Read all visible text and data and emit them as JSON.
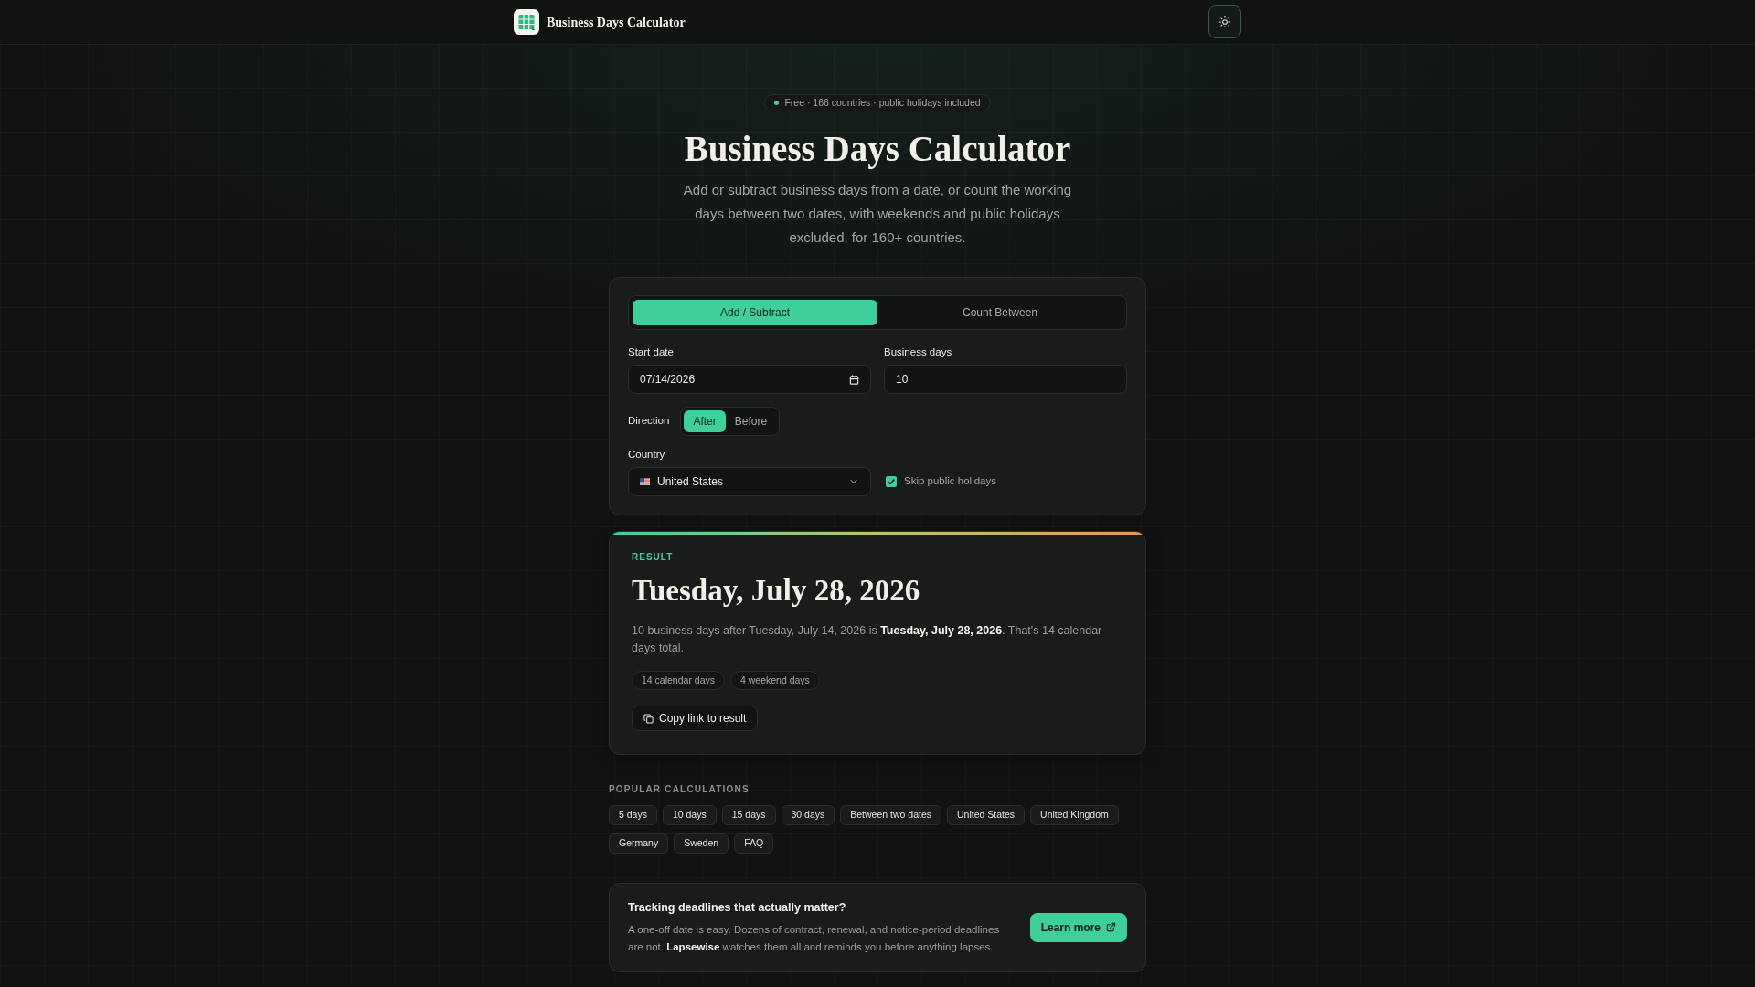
{
  "header": {
    "title": "Business Days Calculator"
  },
  "hero": {
    "badge": "Free · 166 countries · public holidays included",
    "title": "Business Days Calculator",
    "subtitle": "Add or subtract business days from a date, or count the working days between two dates, with weekends and public holidays excluded, for 160+ countries."
  },
  "calculator": {
    "tabs": [
      {
        "label": "Add / Subtract",
        "selected": true
      },
      {
        "label": "Count Between",
        "selected": false
      }
    ],
    "fields": [
      {
        "kind": "date",
        "label": "Start date",
        "value": "07/14/2026"
      },
      {
        "kind": "number",
        "label": "Business days",
        "value": "10"
      }
    ],
    "direction": {
      "label": "Direction",
      "options": [
        {
          "label": "After",
          "selected": true
        },
        {
          "label": "Before",
          "selected": false
        }
      ]
    },
    "country": {
      "label": "Country",
      "value": "United States"
    },
    "skip_holidays": {
      "label": "Skip public holidays",
      "checked": true
    }
  },
  "result": {
    "label": "RESULT",
    "date": "Tuesday, July 28, 2026",
    "summary": "10 business days after Tuesday, July 14, 2026 is **Tuesday, July 28, 2026**. That's 14 calendar days total.",
    "chips": [
      "14 calendar days",
      "4 weekend days"
    ],
    "copy_button": "Copy link to result"
  },
  "popular": {
    "heading": "POPULAR CALCULATIONS",
    "links": [
      "5 days",
      "10 days",
      "15 days",
      "30 days",
      "Between two dates",
      "United States",
      "United Kingdom",
      "Germany",
      "Sweden",
      "FAQ"
    ]
  },
  "promo": {
    "title": "Tracking deadlines that actually matter?",
    "body": "A one-off date is easy. Dozens of contract, renewal, and notice-period deadlines are not. **Lapsewise** watches them all and reminds you before anything lapses.",
    "button": "Learn more"
  }
}
